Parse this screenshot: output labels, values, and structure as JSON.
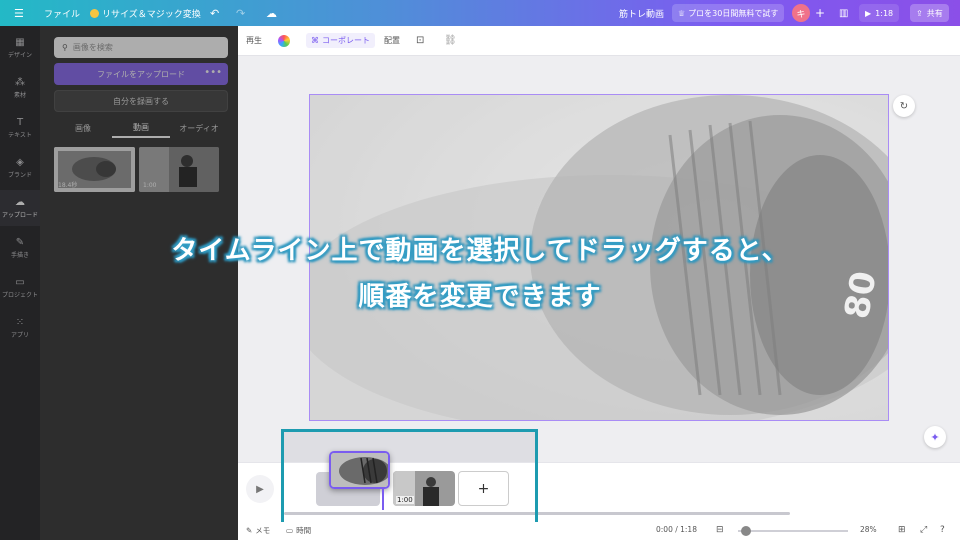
{
  "topbar": {
    "menu_icon": "hamburger-icon",
    "file": "ファイル",
    "resize": "リサイズ＆マジック変換",
    "title": "筋トレ動画",
    "pro_trial": "プロを30日間無料で試す",
    "avatar": "キ",
    "duration": "1:18",
    "share": "共有"
  },
  "sidebar": {
    "items": [
      {
        "label": "デザイン",
        "icon": "design-icon"
      },
      {
        "label": "素材",
        "icon": "elements-icon"
      },
      {
        "label": "テキスト",
        "icon": "text-icon"
      },
      {
        "label": "ブランド",
        "icon": "brand-icon"
      },
      {
        "label": "アップロード",
        "icon": "upload-icon"
      },
      {
        "label": "手描き",
        "icon": "draw-icon"
      },
      {
        "label": "プロジェクト",
        "icon": "folder-icon"
      },
      {
        "label": "アプリ",
        "icon": "apps-icon"
      }
    ]
  },
  "panel": {
    "search_placeholder": "画像を検索",
    "upload_button": "ファイルをアップロード",
    "record_button": "自分を録画する",
    "tabs": [
      "画像",
      "動画",
      "オーディオ"
    ],
    "active_tab": 1,
    "thumbnails": [
      {
        "duration": "18.4秒"
      },
      {
        "duration": "1:00"
      }
    ]
  },
  "toolbar": {
    "play": "再生",
    "collaborate": "コーポレート",
    "arrange": "配置"
  },
  "overlay": {
    "line1": "タイムライン上で動画を選択してドラッグすると、",
    "line2": "順番を変更できます"
  },
  "timeline": {
    "clip2_duration": "1:00",
    "add_label": "+"
  },
  "bottombar": {
    "memo": "メモ",
    "timing": "時間",
    "time": "0:00 / 1:18",
    "zoom": "28%"
  },
  "colors": {
    "accent": "#7a5cf0",
    "highlight": "#1d9bb0",
    "overlay_outline": "#2a8fb8"
  }
}
